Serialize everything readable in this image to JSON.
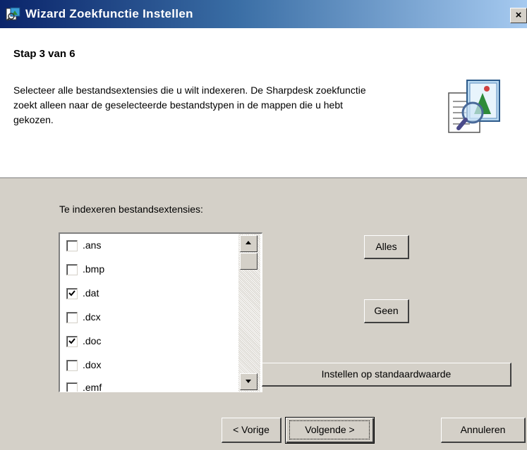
{
  "window": {
    "title": "Wizard Zoekfunctie Instellen",
    "close_label": "×"
  },
  "header": {
    "step": "Stap 3 van 6",
    "description": "Selecteer alle bestandsextensies die u wilt indexeren. De Sharpdesk zoekfunctie zoekt alleen naar de geselecteerde bestandstypen in de mappen die u hebt gekozen.",
    "icon": "wizard-search-document-icon"
  },
  "list": {
    "label": "Te indexeren bestandsextensies:",
    "items": [
      {
        "ext": ".ans",
        "checked": false
      },
      {
        "ext": ".bmp",
        "checked": false
      },
      {
        "ext": ".dat",
        "checked": true
      },
      {
        "ext": ".dcx",
        "checked": false
      },
      {
        "ext": ".doc",
        "checked": true
      },
      {
        "ext": ".dox",
        "checked": false
      },
      {
        "ext": ".emf",
        "checked": false
      }
    ]
  },
  "buttons": {
    "all": "Alles",
    "none": "Geen",
    "default": "Instellen op standaardwaarde",
    "back": "< Vorige",
    "next": "Volgende >",
    "cancel": "Annuleren"
  },
  "colors": {
    "titlebar_start": "#0a246a",
    "titlebar_end": "#a6caf0",
    "dialog_face": "#d4d0c8"
  }
}
